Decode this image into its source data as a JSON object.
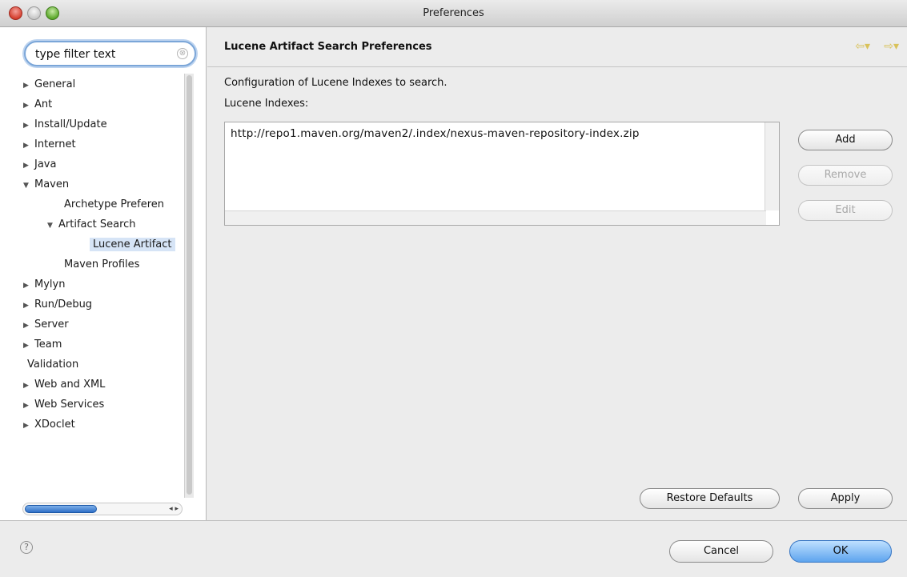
{
  "window": {
    "title": "Preferences"
  },
  "filter": {
    "value": "type filter text",
    "clear_glyph": "⊗"
  },
  "tree": [
    {
      "label": "General",
      "expander": "▶"
    },
    {
      "label": "Ant",
      "expander": "▶"
    },
    {
      "label": "Install/Update",
      "expander": "▶"
    },
    {
      "label": "Internet",
      "expander": "▶"
    },
    {
      "label": "Java",
      "expander": "▶"
    },
    {
      "label": "Maven",
      "expander": "▼"
    },
    {
      "label": "Archetype Preferen",
      "expander": ""
    },
    {
      "label": "Artifact Search",
      "expander": "▼"
    },
    {
      "label": "Lucene Artifact",
      "expander": "",
      "selected": true
    },
    {
      "label": "Maven Profiles",
      "expander": ""
    },
    {
      "label": "Mylyn",
      "expander": "▶"
    },
    {
      "label": "Run/Debug",
      "expander": "▶"
    },
    {
      "label": "Server",
      "expander": "▶"
    },
    {
      "label": "Team",
      "expander": "▶"
    },
    {
      "label": "Validation",
      "expander": ""
    },
    {
      "label": "Web and XML",
      "expander": "▶"
    },
    {
      "label": "Web Services",
      "expander": "▶"
    },
    {
      "label": "XDoclet",
      "expander": "▶"
    }
  ],
  "page": {
    "title": "Lucene Artifact Search Preferences",
    "nav_back": "⇦▾",
    "nav_forward": "⇨▾",
    "description": "Configuration of Lucene Indexes to search.",
    "list_label": "Lucene Indexes:",
    "indexes": [
      "http://repo1.maven.org/maven2/.index/nexus-maven-repository-index.zip"
    ]
  },
  "buttons": {
    "add": "Add",
    "remove": "Remove",
    "edit": "Edit",
    "restore_defaults": "Restore Defaults",
    "apply": "Apply",
    "cancel": "Cancel",
    "ok": "OK"
  },
  "help": {
    "glyph": "?"
  },
  "h_scroll_arrows": "◂ ▸",
  "colors": {
    "selection": "#d6e4f6",
    "default_button": "#5ea4ee",
    "nav_arrow": "#d9c25a"
  }
}
